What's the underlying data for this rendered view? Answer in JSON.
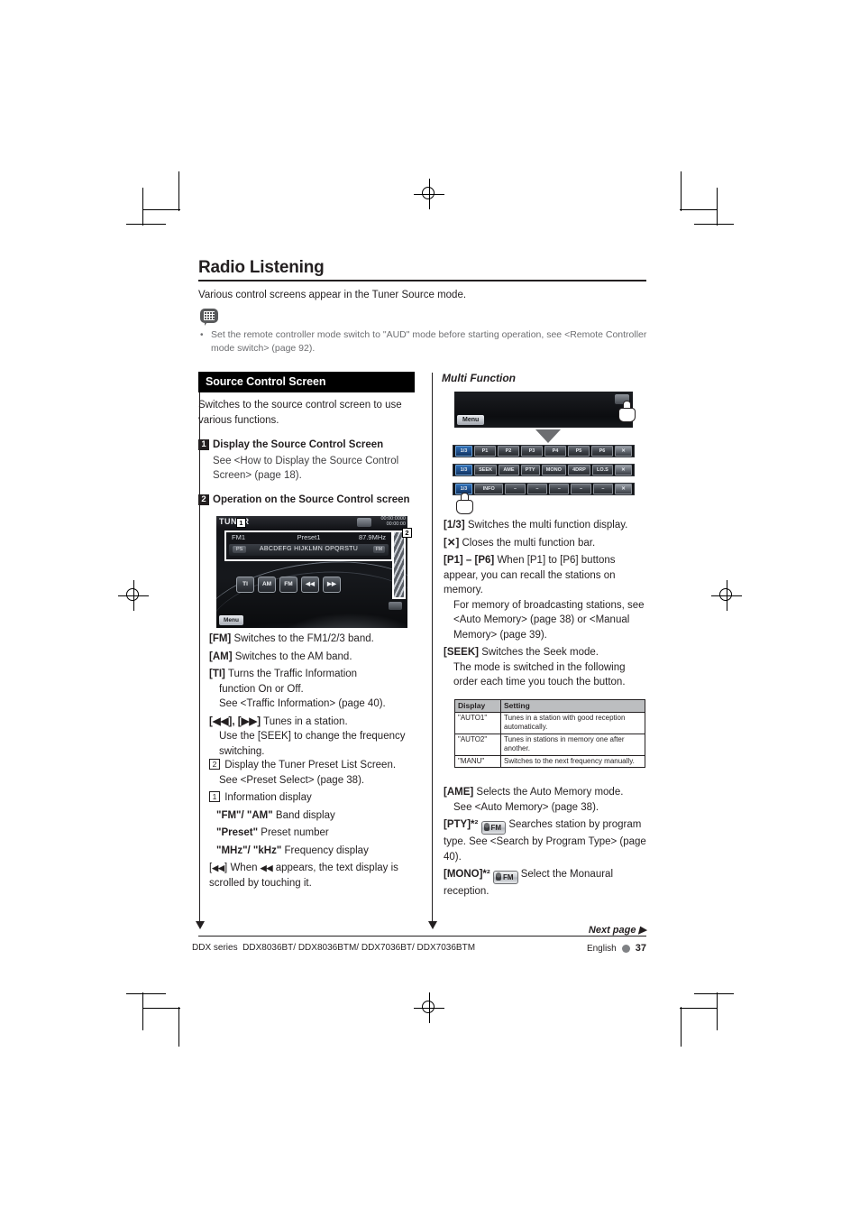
{
  "page": {
    "title": "Radio Listening",
    "intro": "Various control screens appear in the Tuner Source mode.",
    "note_bullet": "•",
    "note": "Set the remote controller mode switch to \"AUD\" mode before starting operation, see <Remote Controller mode switch> (page 92)."
  },
  "left": {
    "section_heading": "Source Control Screen",
    "section_body": "Switches to the source control screen to use various functions.",
    "steps": [
      {
        "num": "1",
        "title": "Display the Source Control Screen",
        "sub": "See <How to Display the Source Control Screen> (page 18)."
      },
      {
        "num": "2",
        "title": "Operation on the Source Control screen",
        "sub": ""
      }
    ],
    "device_screen": {
      "source": "TUNER",
      "clock_line1": "00:00:0000",
      "clock_line2": "00:00:00",
      "top_icon": "mode-icon",
      "band": "FM1",
      "preset": "Preset1",
      "frequency": "87.9MHz",
      "ps_label": "PS",
      "radio_text": "ABCDEFG HIJKLMN OPQRSTU",
      "scroll_label": "FM",
      "keys": [
        "TI",
        "AM",
        "FM",
        "◀◀",
        "▶▶"
      ],
      "menu_label": "Menu",
      "callout_1": "1",
      "callout_2": "2"
    },
    "items": [
      {
        "key": "[FM]",
        "text": "Switches to the FM1/2/3 band.",
        "extra": []
      },
      {
        "key": "[AM]",
        "text": "Switches to the AM band.",
        "extra": []
      },
      {
        "key": "[TI]",
        "text": "Turns the Traffic Information",
        "extra": [
          "function On or Off.",
          "See <Traffic Information> (page 40)."
        ]
      },
      {
        "key": "[◀◀], [▶▶]",
        "text": "Tunes in a station.",
        "extra": [
          "Use the [SEEK] to change the frequency switching."
        ]
      }
    ],
    "numbered_items": [
      {
        "num": "2",
        "text": "Display the Tuner Preset List Screen.",
        "extra": [
          "See <Preset Select> (page 38)."
        ]
      },
      {
        "num": "1",
        "text": "Information display",
        "extra": []
      }
    ],
    "info_lines": [
      {
        "key": "\"FM\"/ \"AM\"",
        "text": "Band display"
      },
      {
        "key": "\"Preset\"",
        "text": "Preset number"
      },
      {
        "key": "\"MHz\"/ \"kHz\"",
        "text": "Frequency display"
      }
    ],
    "scroll_item": {
      "key_prefix": "[",
      "key_icon": "◀◀",
      "key_suffix": "]",
      "text_a": "When",
      "text_b": "appears, the text display is scrolled by touching it."
    }
  },
  "right": {
    "multi_function_title": "Multi Function",
    "screen": {
      "menu_label": "Menu",
      "close_icon": "close-bar-icon"
    },
    "bars": [
      {
        "cells": [
          "1/3",
          "P1",
          "P2",
          "P3",
          "P4",
          "P5",
          "P6",
          "✕"
        ]
      },
      {
        "cells": [
          "1/3",
          "SEEK",
          "AME",
          "PTY",
          "MONO",
          "4DRP",
          "LO.S",
          "✕"
        ]
      },
      {
        "cells": [
          "1/3",
          "INFO",
          "–",
          "–",
          "–",
          "–",
          "–",
          "✕"
        ]
      }
    ],
    "items": [
      {
        "key": "[1/3]",
        "text": "Switches the multi function display.",
        "extra": []
      },
      {
        "key": "[✕]",
        "text": "Closes the multi function bar.",
        "extra": []
      },
      {
        "key": "[P1] – [P6]",
        "text": "When [P1] to [P6] buttons appear, you can recall the stations on memory.",
        "extra": [
          "For memory of broadcasting stations, see <Auto Memory> (page 38) or <Manual Memory> (page 39)."
        ]
      },
      {
        "key": "[SEEK]",
        "text": "Switches the Seek mode.",
        "extra": [
          "The mode is switched in the following order each time you touch the button."
        ]
      }
    ],
    "table": {
      "headers": [
        "Display",
        "Setting"
      ],
      "rows": [
        [
          "\"AUTO1\"",
          "Tunes in a station with good reception automatically."
        ],
        [
          "\"AUTO2\"",
          "Tunes in stations in memory one after another."
        ],
        [
          "\"MANU\"",
          "Switches to the next frequency manually."
        ]
      ]
    },
    "items2": [
      {
        "key": "[AME]",
        "badge": "",
        "text": "Selects the Auto Memory mode.",
        "extra": [
          "See <Auto Memory> (page 38)."
        ]
      },
      {
        "key": "[PTY]*²",
        "badge": "FM",
        "text": "Searches station by program type. See <Search by Program Type> (page 40).",
        "extra": []
      },
      {
        "key": "[MONO]*²",
        "badge": "FM",
        "text": "Select the Monaural reception.",
        "extra": []
      }
    ]
  },
  "footer": {
    "next_page": "Next page ▶",
    "model_prefix": "DDX series",
    "models": "DDX8036BT/ DDX8036BTM/ DDX7036BT/ DDX7036BTM",
    "language": "English",
    "page_number": "37"
  },
  "colors": {
    "ink": "#231f20",
    "section_bar": "#000000",
    "table_header": "#bcbec0",
    "footer_dot": "#808285"
  }
}
